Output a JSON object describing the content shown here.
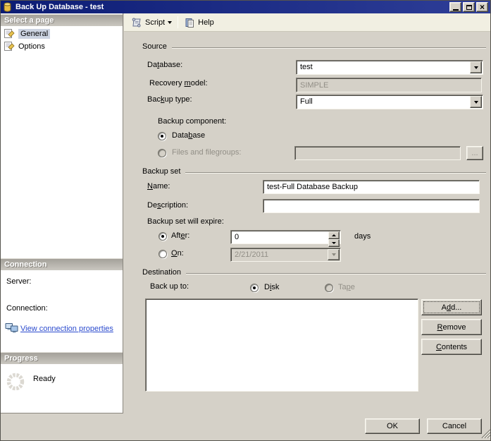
{
  "window": {
    "title": "Back Up Database - test"
  },
  "toolbar": {
    "script": "Script",
    "help": "Help"
  },
  "sidebar": {
    "select_page_header": "Select a page",
    "pages": [
      {
        "label": "General",
        "selected": true
      },
      {
        "label": "Options",
        "selected": false
      }
    ],
    "connection_header": "Connection",
    "server_label": "Server:",
    "connection_label": "Connection:",
    "view_connection_link": "View connection properties",
    "progress_header": "Progress",
    "progress_status": "Ready"
  },
  "source": {
    "header": "Source",
    "database_label": "Da&tabase:",
    "database_value": "test",
    "recovery_model_label": "Recovery &model:",
    "recovery_model_value": "SIMPLE",
    "backup_type_label": "Bac&kup type:",
    "backup_type_value": "Full",
    "backup_component_label": "Backup component:",
    "database_radio_label": "Data&base",
    "files_radio_label": "Files and filegroups:",
    "files_value": "",
    "browse_button": "..."
  },
  "backup_set": {
    "header": "Backup set",
    "name_label": "&Name:",
    "name_value": "test-Full Database Backup",
    "description_label": "De&scription:",
    "description_value": "",
    "expire_label": "Backup set will expire:",
    "after_radio_label": "Aft&er:",
    "after_value": "0",
    "after_unit": "days",
    "on_radio_label": "&On:",
    "on_value": "2/21/2011"
  },
  "destination": {
    "header": "Destination",
    "back_up_to_label": "Back up to:",
    "disk_radio_label": "D&isk",
    "tape_radio_label": "Ta&pe",
    "device_list": [],
    "add_button": "A&dd...",
    "remove_button": "&Remove",
    "contents_button": "&Contents"
  },
  "footer": {
    "ok_button": "OK",
    "cancel_button": "Cancel"
  },
  "colors": {
    "titlebar_blue": "#101f78",
    "dialog_face": "#d5d1c8",
    "toolbar_bg": "#f1efe2",
    "sidebar_bg": "#ffffff",
    "section_header_gradient_top": "#a4a19a",
    "section_header_gradient_bottom": "#cac7c0",
    "selected_page_bg": "#ccd4e2",
    "link_blue": "#2b4bce",
    "disabled_text": "#928f87",
    "database_icon_yellow": "#e9bd43"
  },
  "icons": {
    "titlebar": "database-icon",
    "page_items": "page-icon",
    "script": "script-scroll-icon",
    "help": "help-book-icon",
    "connection": "computer-network-icon",
    "progress": "spinner-icon"
  }
}
